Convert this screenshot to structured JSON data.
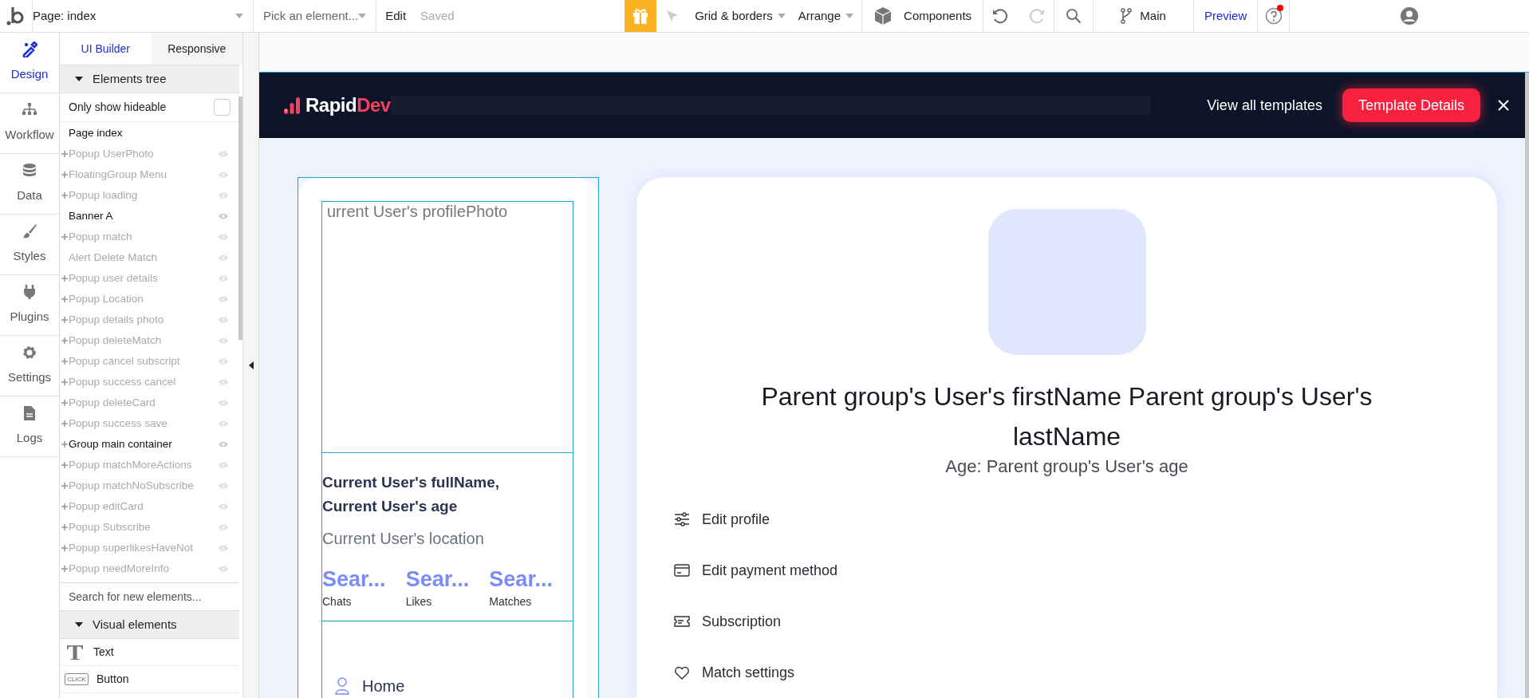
{
  "toolbar": {
    "page_selector": "Page: index",
    "element_picker": "Pick an element...",
    "edit": "Edit",
    "save_status": "Saved",
    "grid_menu": "Grid & borders",
    "arrange_menu": "Arrange",
    "components": "Components",
    "branch": "Main",
    "preview": "Preview"
  },
  "rail": [
    {
      "label": "Design",
      "kind": "design",
      "selected": true
    },
    {
      "label": "Workflow",
      "kind": "workflow",
      "selected": false
    },
    {
      "label": "Data",
      "kind": "data",
      "selected": false
    },
    {
      "label": "Styles",
      "kind": "styles",
      "selected": false
    },
    {
      "label": "Plugins",
      "kind": "plugins",
      "selected": false
    },
    {
      "label": "Settings",
      "kind": "settings",
      "selected": false
    },
    {
      "label": "Logs",
      "kind": "logs",
      "selected": false
    }
  ],
  "panel": {
    "tabs": [
      {
        "label": "UI Builder",
        "selected": true
      },
      {
        "label": "Responsive",
        "selected": false
      }
    ],
    "tree_header": "Elements tree",
    "hideable": {
      "label": "Only show hideable",
      "checked": false
    },
    "tree": [
      {
        "label": "Page index",
        "kind": "page",
        "expandable": false,
        "hidden": false
      },
      {
        "label": "Popup UserPhoto",
        "kind": "element",
        "expandable": true,
        "hidden": true
      },
      {
        "label": "FloatingGroup Menu",
        "kind": "element",
        "expandable": true,
        "hidden": true
      },
      {
        "label": "Popup loading",
        "kind": "element",
        "expandable": true,
        "hidden": true
      },
      {
        "label": "Banner A",
        "kind": "element",
        "expandable": false,
        "hidden": false
      },
      {
        "label": "Popup match",
        "kind": "element",
        "expandable": true,
        "hidden": true
      },
      {
        "label": "Alert Delete Match",
        "kind": "element",
        "expandable": false,
        "hidden": true
      },
      {
        "label": "Popup user details",
        "kind": "element",
        "expandable": true,
        "hidden": true
      },
      {
        "label": "Popup Location",
        "kind": "element",
        "expandable": true,
        "hidden": true
      },
      {
        "label": "Popup details photo",
        "kind": "element",
        "expandable": true,
        "hidden": true
      },
      {
        "label": "Popup deleteMatch",
        "kind": "element",
        "expandable": true,
        "hidden": true
      },
      {
        "label": "Popup cancel subscript",
        "kind": "element",
        "expandable": true,
        "hidden": true
      },
      {
        "label": "Popup success cancel",
        "kind": "element",
        "expandable": true,
        "hidden": true
      },
      {
        "label": "Popup deleteCard",
        "kind": "element",
        "expandable": true,
        "hidden": true
      },
      {
        "label": "Popup success save",
        "kind": "element",
        "expandable": true,
        "hidden": true
      },
      {
        "label": "Group main container",
        "kind": "element",
        "expandable": true,
        "hidden": false
      },
      {
        "label": "Popup matchMoreActions",
        "kind": "element",
        "expandable": true,
        "hidden": true
      },
      {
        "label": "Popup matchNoSubscribe",
        "kind": "element",
        "expandable": true,
        "hidden": true
      },
      {
        "label": "Popup editCard",
        "kind": "element",
        "expandable": true,
        "hidden": true
      },
      {
        "label": "Popup Subscribe",
        "kind": "element",
        "expandable": true,
        "hidden": true
      },
      {
        "label": "Popup superlikesHaveNot",
        "kind": "element",
        "expandable": true,
        "hidden": true
      },
      {
        "label": "Popup needMoreInfo",
        "kind": "element",
        "expandable": true,
        "hidden": true
      }
    ],
    "search_placeholder": "Search for new elements...",
    "visual_header": "Visual elements",
    "visual_elements": [
      {
        "label": "Text",
        "kind": "text"
      },
      {
        "label": "Button",
        "kind": "button",
        "icon_text": "CLICK"
      }
    ]
  },
  "banner": {
    "brand_first": "Rapid",
    "brand_second": "Dev",
    "link": "View all templates",
    "button": "Template Details"
  },
  "profile_card": {
    "photo_placeholder": "urrent User's profilePhoto",
    "full_name": "Current User's fullName, Current User's age",
    "location": "Current User's location",
    "stats": [
      {
        "value": "Sear...",
        "label": "Chats"
      },
      {
        "value": "Sear...",
        "label": "Likes"
      },
      {
        "value": "Sear...",
        "label": "Matches"
      }
    ],
    "nav": [
      {
        "label": "Home",
        "kind": "person"
      }
    ]
  },
  "details_card": {
    "name": "Parent group's User's firstName Parent group's User's lastName",
    "age": "Age: Parent group's User's age",
    "menu": [
      {
        "label": "Edit profile",
        "kind": "sliders"
      },
      {
        "label": "Edit payment method",
        "kind": "card"
      },
      {
        "label": "Subscription",
        "kind": "ticket"
      },
      {
        "label": "Match settings",
        "kind": "heart"
      }
    ]
  }
}
